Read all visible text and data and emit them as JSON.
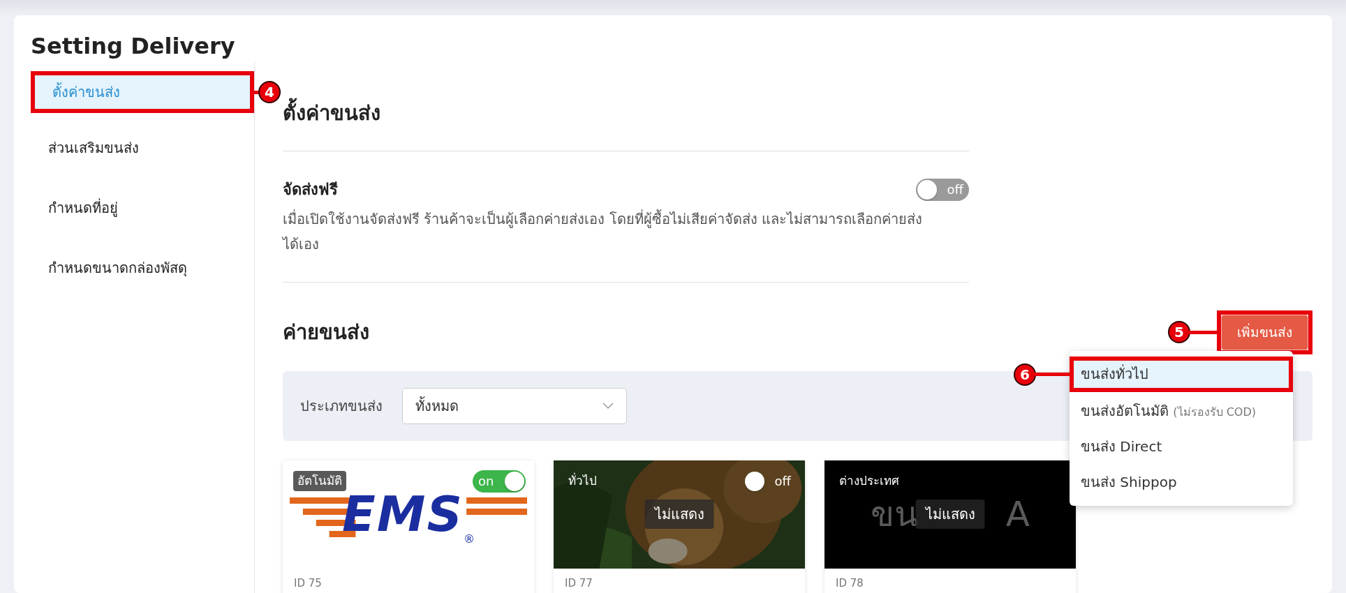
{
  "page_title": "Setting Delivery",
  "sidebar": {
    "items": [
      {
        "label": "ตั้งค่าขนส่ง",
        "selected": true,
        "callout": "4"
      },
      {
        "label": "ส่วนเสริมขนส่ง",
        "selected": false
      },
      {
        "label": "กำหนดที่อยู่",
        "selected": false
      },
      {
        "label": "กำหนดขนาดกล่องพัสดุ",
        "selected": false
      }
    ]
  },
  "settings": {
    "heading": "ตั้งค่าขนส่ง",
    "free_shipping": {
      "title": "จัดส่งฟรี",
      "on": false,
      "toggle_text": "off",
      "description": "เมื่อเปิดใช้งานจัดส่งฟรี ร้านค้าจะเป็นผู้เลือกค่ายส่งเอง โดยที่ผู้ซื้อไม่เสียค่าจัดส่ง และไม่สามารถเลือกค่ายส่งได้เอง"
    }
  },
  "carriers": {
    "heading": "ค่ายขนส่ง",
    "add_button": {
      "label": "เพิ่มขนส่ง",
      "callout": "5"
    },
    "menu": [
      {
        "label": "ขนส่งทั่วไป",
        "selected": true,
        "callout": "6"
      },
      {
        "label": "ขนส่งอัตโนมัติ",
        "note": "(ไม่รองรับ COD)",
        "selected": false
      },
      {
        "label": "ขนส่ง Direct",
        "selected": false
      },
      {
        "label": "ขนส่ง Shippop",
        "selected": false
      }
    ],
    "filter": {
      "label": "ประเภทขนส่ง",
      "value": "ทั้งหมด"
    },
    "cards": [
      {
        "kind": "ems",
        "logo_text": "EMS",
        "logo_mark": "®",
        "badge": "อัตโนมัติ",
        "on": true,
        "toggle_text": "on",
        "id": "ID 75"
      },
      {
        "kind": "picture",
        "badge": "ทั่วไป",
        "on": false,
        "toggle_text": "off",
        "hidden_label": "ไม่แสดง",
        "id": "ID 77"
      },
      {
        "kind": "text-logo",
        "logo_fragments": [
          "ขน",
          "A"
        ],
        "badge": "ต่างประเทศ",
        "hidden_label": "ไม่แสดง",
        "id": "ID 78"
      }
    ]
  }
}
